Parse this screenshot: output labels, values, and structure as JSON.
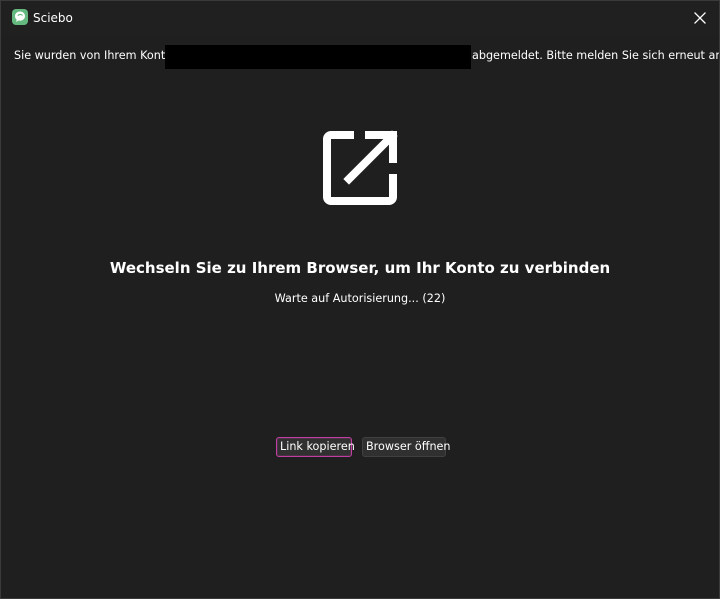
{
  "window": {
    "title": "Sciebo"
  },
  "notice": {
    "before_redaction": "Sie wurden von Ihrem Konto",
    "after_redaction": "abgemeldet. Bitte melden Sie sich erneut an."
  },
  "main": {
    "icon": "external-link-icon",
    "headline": "Wechseln Sie zu Ihrem Browser, um Ihr Konto zu verbinden",
    "status": "Warte auf Autorisierung... (22)"
  },
  "actions": {
    "copy_link_label": "Link kopieren",
    "open_browser_label": "Browser öffnen"
  },
  "colors": {
    "background": "#1f1f1f",
    "focus_outline": "#c13fa2",
    "app_icon": "#63b97f"
  }
}
